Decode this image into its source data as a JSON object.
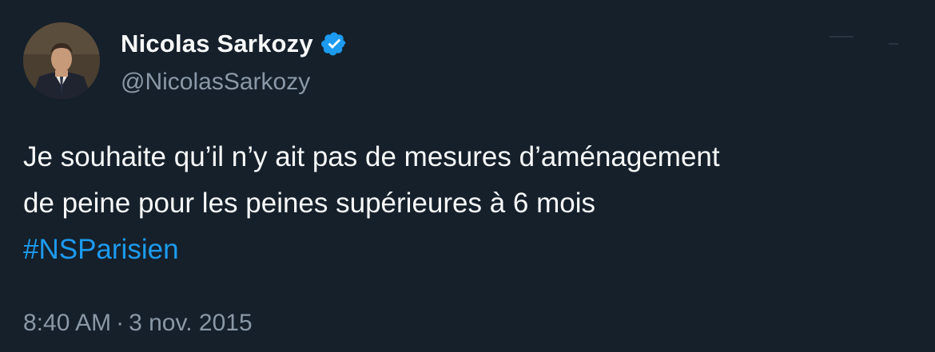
{
  "author": {
    "display_name": "Nicolas Sarkozy",
    "handle": "@NicolasSarkozy",
    "verified_icon": "verified-badge-icon",
    "avatar_icon": "profile-photo"
  },
  "tweet": {
    "text_line_1": "Je souhaite qu’il n’y ait pas de mesures d’aménagement",
    "text_line_2": "de peine pour les peines supérieures à 6 mois",
    "hashtag": "#NSParisien"
  },
  "meta": {
    "time": "8:40 AM",
    "separator": "·",
    "date": "3 nov. 2015"
  },
  "colors": {
    "background": "#15202b",
    "primary_text": "#f7f9f9",
    "secondary_text": "#8b98a5",
    "accent": "#1d9bf0"
  }
}
